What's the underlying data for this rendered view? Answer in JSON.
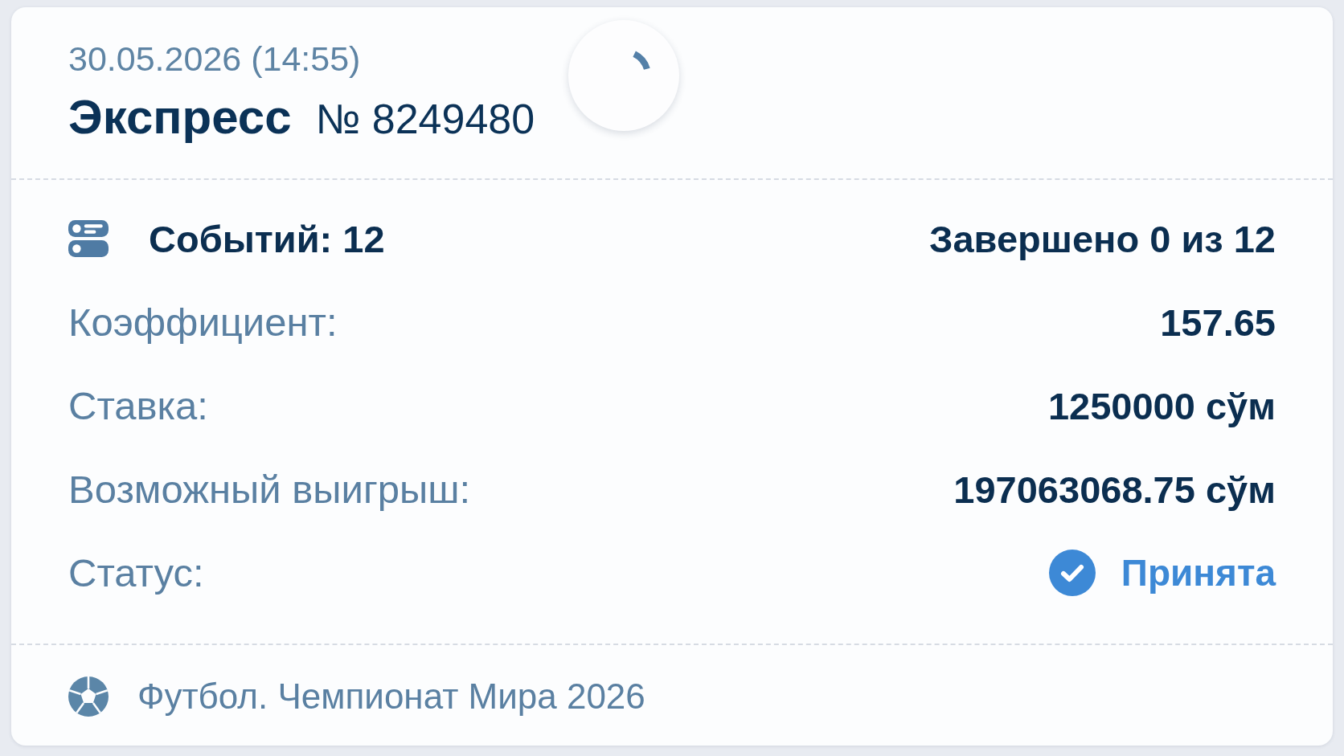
{
  "bet": {
    "date": "30.05.2026 (14:55)",
    "type": "Экспресс",
    "number": "№ 8249480",
    "events": {
      "count": "Событий: 12",
      "completed": "Завершено 0 из 12"
    },
    "details": [
      {
        "kind": "value",
        "label": "Коэффициент:",
        "value": "157.65"
      },
      {
        "kind": "value",
        "label": "Ставка:",
        "value": "1250000 сўм"
      },
      {
        "kind": "value",
        "label": "Возможный выигрыш:",
        "value": "197063068.75 сўм"
      },
      {
        "kind": "status",
        "label": "Статус:",
        "value": "Принята"
      }
    ],
    "tournament": "Футбол. Чемпионат Мира 2026"
  }
}
